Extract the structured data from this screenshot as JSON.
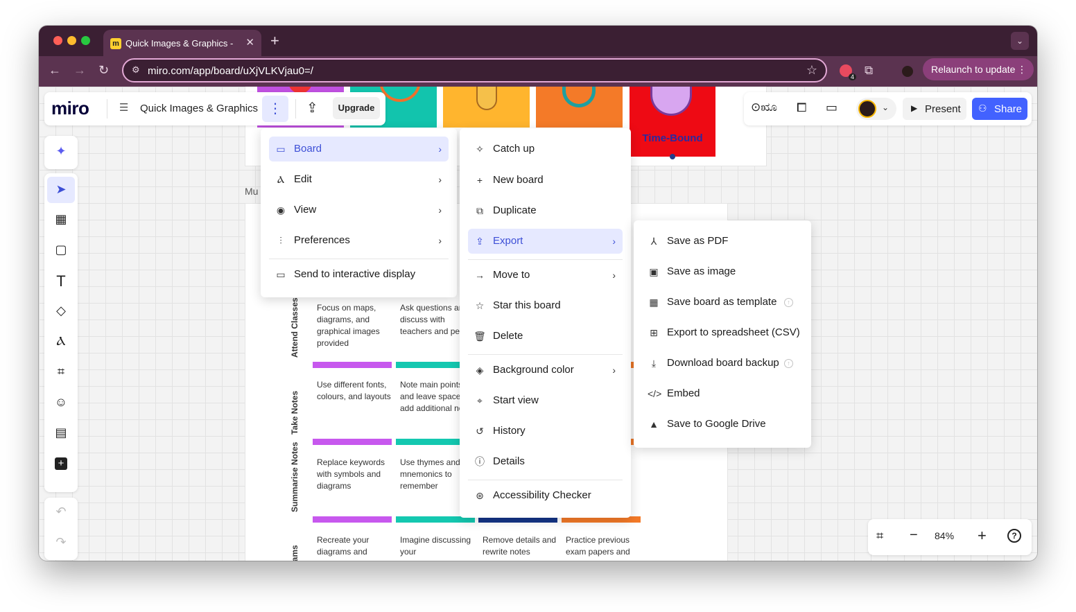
{
  "browser": {
    "tab_title": "Quick Images & Graphics - M",
    "tab_close": "✕",
    "new_tab": "+",
    "url": "miro.com/app/board/uXjVLKVjau0=/",
    "ext_badge": "4",
    "relaunch_label": "Relaunch to update"
  },
  "miro": {
    "logo": "miro",
    "board_title": "Quick Images & Graphics",
    "upgrade_label": "Upgrade",
    "present_label": "Present",
    "share_label": "Share",
    "zoom": "84%",
    "accent_color": "#3d4fd6"
  },
  "board": {
    "time_bound": "Time-Bound",
    "frame_label": "Mu",
    "rows": [
      {
        "label": "Attend Classes",
        "cells": [
          "Focus on maps, diagrams, and graphical images provided",
          "Ask questions and discuss with teachers and peers",
          "",
          ""
        ]
      },
      {
        "label": "Take Notes",
        "cells": [
          "Use different fonts, colours, and layouts",
          "Note main points and leave space to add additional notes",
          "",
          ""
        ]
      },
      {
        "label": "Summarise Notes",
        "cells": [
          "Replace keywords with symbols and diagrams",
          "Use thymes and mnemonics to remember",
          "",
          ""
        ]
      },
      {
        "label": "are for ams",
        "cells": [
          "Recreate your diagrams and",
          "Imagine discussing your",
          "Remove details and rewrite notes",
          "Practice previous exam papers and"
        ]
      }
    ]
  },
  "menu_main": {
    "items": [
      {
        "label": "Board",
        "icon": "board-icon"
      },
      {
        "label": "Edit",
        "icon": "pen-icon"
      },
      {
        "label": "View",
        "icon": "eye-icon"
      },
      {
        "label": "Preferences",
        "icon": "sliders-icon"
      },
      {
        "label": "Send to interactive display",
        "icon": "display-icon"
      }
    ]
  },
  "menu_board": {
    "items": [
      {
        "label": "Catch up",
        "icon": "sparkle-icon"
      },
      {
        "label": "New board",
        "icon": "plus-icon"
      },
      {
        "label": "Duplicate",
        "icon": "duplicate-icon"
      },
      {
        "label": "Export",
        "icon": "export-icon"
      },
      {
        "label": "Move to",
        "icon": "arrow-right-icon"
      },
      {
        "label": "Star this board",
        "icon": "star-icon"
      },
      {
        "label": "Delete",
        "icon": "trash-icon"
      },
      {
        "label": "Background color",
        "icon": "paint-bucket-icon"
      },
      {
        "label": "Start view",
        "icon": "start-view-icon"
      },
      {
        "label": "History",
        "icon": "history-icon"
      },
      {
        "label": "Details",
        "icon": "info-icon"
      },
      {
        "label": "Accessibility Checker",
        "icon": "accessibility-icon"
      }
    ]
  },
  "menu_export": {
    "items": [
      {
        "label": "Save as PDF",
        "icon": "pdf-icon"
      },
      {
        "label": "Save as image",
        "icon": "image-icon"
      },
      {
        "label": "Save board as template",
        "icon": "template-icon"
      },
      {
        "label": "Export to spreadsheet (CSV)",
        "icon": "table-icon"
      },
      {
        "label": "Download board backup",
        "icon": "download-icon"
      },
      {
        "label": "Embed",
        "icon": "code-icon"
      },
      {
        "label": "Save to Google Drive",
        "icon": "google-drive-icon"
      }
    ]
  }
}
